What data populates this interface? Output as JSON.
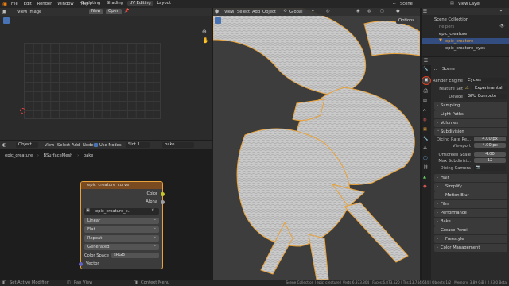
{
  "topbar": {
    "menus": [
      "File",
      "Edit",
      "Render",
      "Window",
      "Help"
    ],
    "workspaces": [
      "Sculpting",
      "Shading",
      "UV Editing",
      "Layout"
    ],
    "active_workspace": "UV Editing",
    "scene": "Scene",
    "view_layer": "View Layer"
  },
  "image_editor": {
    "menus": [
      "View",
      "Image"
    ],
    "new_label": "New",
    "open_label": "Open"
  },
  "viewport": {
    "menus": [
      "View",
      "Select",
      "Add",
      "Object"
    ],
    "orientation": "Global",
    "options_label": "Options"
  },
  "node_editor": {
    "mode": "Object",
    "menus": [
      "View",
      "Select",
      "Add",
      "Node"
    ],
    "use_nodes_label": "Use Nodes",
    "slot": "Slot 1",
    "material": "bake",
    "breadcrumb": [
      "epic_creature",
      "BSurfaceMesh",
      "bake"
    ],
    "node": {
      "title": "epic_creature_curve_",
      "out_color": "Color",
      "out_alpha": "Alpha",
      "image_name": "epic_creature_c...",
      "interpolation": "Linear",
      "projection": "Flat",
      "extension": "Repeat",
      "source": "Generated",
      "color_space_label": "Color Space",
      "color_space": "sRGB",
      "in_vector": "Vector"
    }
  },
  "outliner": {
    "title": "Scene Collection",
    "items": [
      "helpers",
      "epic_creature",
      "epic_creature",
      "epic_creature_eyes"
    ]
  },
  "properties": {
    "header": "Scene",
    "render_engine_label": "Render Engine",
    "render_engine": "Cycles",
    "feature_set_label": "Feature Set",
    "feature_set": "Experimental",
    "device_label": "Device",
    "device": "GPU Compute",
    "sections_a": [
      "Sampling",
      "Light Paths",
      "Volumes"
    ],
    "subdivision": "Subdivision",
    "dicing_rate_label": "Dicing Rate Re...",
    "dicing_rate": "4.00 px",
    "viewport_label": "Viewport",
    "viewport_value": "4.00 px",
    "offscreen_label": "Offscreen Scale",
    "offscreen": "4.00",
    "max_subdiv_label": "Max Subdivisi...",
    "max_subdiv": "12",
    "dicing_camera_label": "Dicing Camera",
    "sections_b": [
      "Hair",
      "Simplify",
      "Motion Blur",
      "Film",
      "Performance",
      "Bake",
      "Grease Pencil",
      "Freestyle",
      "Color Management"
    ]
  },
  "statusbar": {
    "left": [
      "Set Active Modifier",
      "Pan View",
      "Context Menu"
    ],
    "right": "Scene Collection | epic_creature | Verts:6,873,804 | Faces:6,873,520 | Tris:13,744,644 | Objects:1/2 | Memory: 3.89 GiB | 2.93.0 Beta"
  },
  "colors": {
    "accent": "#4772b3",
    "orange": "#e8a23a",
    "active": "#e8a23a"
  }
}
